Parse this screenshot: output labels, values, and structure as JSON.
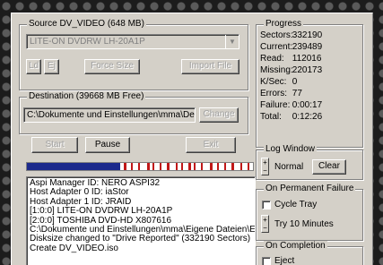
{
  "source": {
    "legend": "Source  DV_VIDEO  (648 MB)",
    "drive": "LITE-ON DVDRW LH-20A1P",
    "buttons": [
      "Ld",
      "Ej",
      "Force Size",
      "Import File"
    ]
  },
  "destination": {
    "legend": "Destination  (39668 MB Free)",
    "path": "C:\\Dokumente und Einstellungen\\mma\\Des",
    "change_label": "Change"
  },
  "controls": {
    "start": "Start",
    "pause": "Pause",
    "exit": "Exit"
  },
  "progress": {
    "legend": "Progress",
    "rows": [
      {
        "key": "Sectors:",
        "value": "332190"
      },
      {
        "key": "Current:",
        "value": "239489"
      },
      {
        "key": "Read:",
        "value": "112016"
      },
      {
        "key": "Missing:",
        "value": "220173"
      },
      {
        "key": "K/Sec:",
        "value": "0"
      },
      {
        "key": "Errors:",
        "value": "77"
      },
      {
        "key": "Failure:",
        "value": "0:00:17"
      },
      {
        "key": "Total:",
        "value": "0:12:26"
      }
    ]
  },
  "log_window": {
    "legend": "Log Window",
    "level": "Normal",
    "clear": "Clear"
  },
  "on_failure": {
    "legend": "On Permanent Failure",
    "cycle_tray": "Cycle Tray",
    "try_label": "Try 10 Minutes"
  },
  "on_completion": {
    "legend": "On Completion",
    "eject": "Eject"
  },
  "log": [
    "Aspi Manager ID: NERO ASPI32",
    "Host Adapter 0 ID: iaStor",
    "Host Adapter 1 ID: JRAID",
    "[1:0:0]  LITE-ON DVDRW LH-20A1P",
    "[2:0:0]  TOSHIBA DVD-HD  X807616",
    "C:\\Dokumente und Einstellungen\\mma\\Eigene Dateien\\Eig",
    "Disksize changed to \"Drive Reported\" (332190 Sectors)",
    "Create DV_VIDEO.iso"
  ],
  "colors": {
    "read": "#1c2a8c",
    "error": "#c01818",
    "window": "#d4d0c8"
  }
}
